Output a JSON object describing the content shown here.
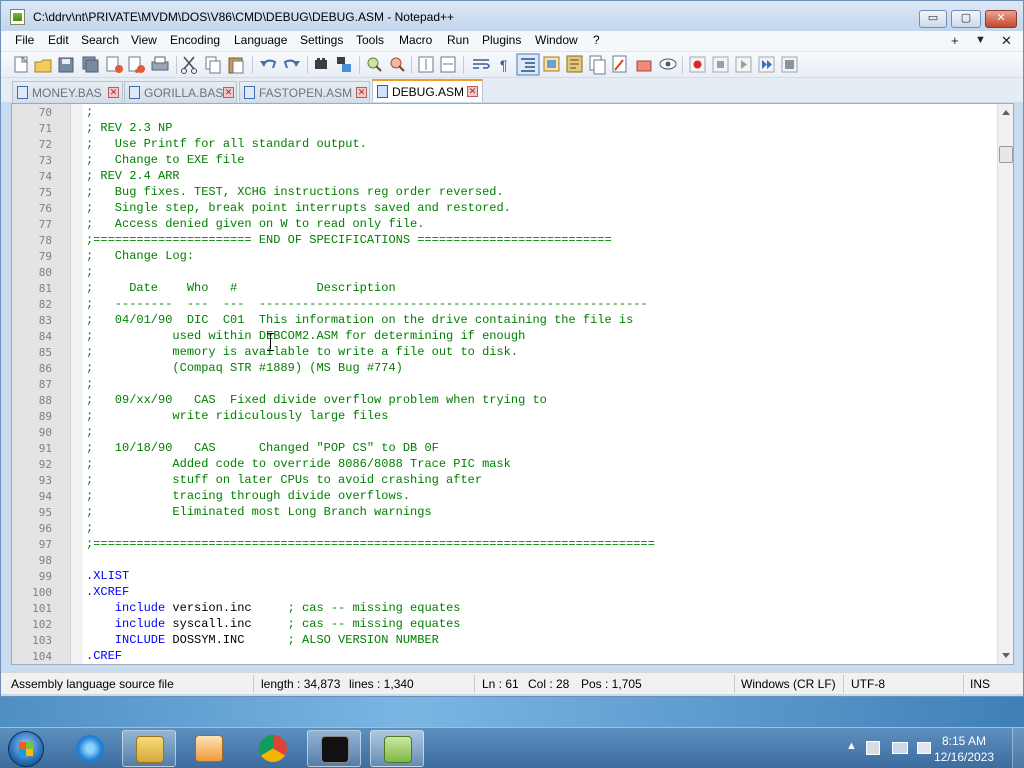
{
  "window": {
    "title": "C:\\ddrv\\nt\\PRIVATE\\MVDM\\DOS\\V86\\CMD\\DEBUG\\DEBUG.ASM - Notepad++",
    "min_glyph": "▭",
    "max_glyph": "▢",
    "close_glyph": "✕"
  },
  "menu": {
    "items": [
      "File",
      "Edit",
      "Search",
      "View",
      "Encoding",
      "Language",
      "Settings",
      "Tools",
      "Macro",
      "Run",
      "Plugins",
      "Window",
      "?"
    ],
    "right": [
      "+",
      "▼",
      "✕"
    ]
  },
  "toolbar": {
    "icons": [
      "new-file",
      "open-file",
      "save",
      "save-all",
      "close",
      "close-all",
      "print",
      "cut",
      "copy",
      "paste",
      "undo",
      "redo",
      "find",
      "replace",
      "zoom-in",
      "zoom-out",
      "sync-vertical",
      "word-wrap",
      "show-all-chars",
      "indent-guide",
      "user-defined-language",
      "document-map",
      "function-list",
      "folder-as-workspace",
      "monitoring",
      "macro-record",
      "macro-stop",
      "macro-play",
      "macro-run-multiple",
      "macro-save"
    ]
  },
  "tabs": [
    {
      "label": "MONEY.BAS",
      "active": false
    },
    {
      "label": "GORILLA.BAS",
      "active": false
    },
    {
      "label": "FASTOPEN.ASM",
      "active": false
    },
    {
      "label": "DEBUG.ASM",
      "active": true
    }
  ],
  "tab_close_glyph": "✕",
  "editor": {
    "lines": [
      {
        "n": "70",
        "parts": [
          {
            "t": ";",
            "c": "cmt"
          }
        ]
      },
      {
        "n": "71",
        "parts": [
          {
            "t": "; REV 2.3 NP",
            "c": "cmt"
          }
        ]
      },
      {
        "n": "72",
        "parts": [
          {
            "t": ";   Use Printf for all standard output.",
            "c": "cmt"
          }
        ]
      },
      {
        "n": "73",
        "parts": [
          {
            "t": ";   Change to EXE file",
            "c": "cmt"
          }
        ]
      },
      {
        "n": "74",
        "parts": [
          {
            "t": "; REV 2.4 ARR",
            "c": "cmt"
          }
        ]
      },
      {
        "n": "75",
        "parts": [
          {
            "t": ";   Bug fixes. TEST, XCHG instructions reg order reversed.",
            "c": "cmt"
          }
        ]
      },
      {
        "n": "76",
        "parts": [
          {
            "t": ";   Single step, break point interrupts saved and restored.",
            "c": "cmt"
          }
        ]
      },
      {
        "n": "77",
        "parts": [
          {
            "t": ";   Access denied given on W to read only file.",
            "c": "cmt"
          }
        ]
      },
      {
        "n": "78",
        "parts": [
          {
            "t": ";====================== END OF SPECIFICATIONS ===========================",
            "c": "cmt"
          }
        ]
      },
      {
        "n": "79",
        "parts": [
          {
            "t": ";   Change Log:",
            "c": "cmt"
          }
        ]
      },
      {
        "n": "80",
        "parts": [
          {
            "t": ";",
            "c": "cmt"
          }
        ]
      },
      {
        "n": "81",
        "parts": [
          {
            "t": ";     Date    Who   #           Description",
            "c": "cmt"
          }
        ]
      },
      {
        "n": "82",
        "parts": [
          {
            "t": ";   --------  ---  ---  ------------------------------------------------------",
            "c": "cmt"
          }
        ]
      },
      {
        "n": "83",
        "parts": [
          {
            "t": ";   04/01/90  DIC  C01  This information on the drive containing the file is",
            "c": "cmt"
          }
        ]
      },
      {
        "n": "84",
        "parts": [
          {
            "t": ";           used within DEBCOM2.ASM for determining if enough",
            "c": "cmt"
          }
        ]
      },
      {
        "n": "85",
        "parts": [
          {
            "t": ";           memory is available to write a file out to disk.",
            "c": "cmt"
          }
        ]
      },
      {
        "n": "86",
        "parts": [
          {
            "t": ";           (Compaq STR #1889) (MS Bug #774)",
            "c": "cmt"
          }
        ]
      },
      {
        "n": "87",
        "parts": [
          {
            "t": ";",
            "c": "cmt"
          }
        ]
      },
      {
        "n": "88",
        "parts": [
          {
            "t": ";   09/xx/90   CAS  Fixed divide overflow problem when trying to",
            "c": "cmt"
          }
        ]
      },
      {
        "n": "89",
        "parts": [
          {
            "t": ";           write ridiculously large files",
            "c": "cmt"
          }
        ]
      },
      {
        "n": "90",
        "parts": [
          {
            "t": ";",
            "c": "cmt"
          }
        ]
      },
      {
        "n": "91",
        "parts": [
          {
            "t": ";   10/18/90   CAS      Changed \"POP CS\" to DB 0F",
            "c": "cmt"
          }
        ]
      },
      {
        "n": "92",
        "parts": [
          {
            "t": ";           Added code to override 8086/8088 Trace PIC mask",
            "c": "cmt"
          }
        ]
      },
      {
        "n": "93",
        "parts": [
          {
            "t": ";           stuff on later CPUs to avoid crashing after",
            "c": "cmt"
          }
        ]
      },
      {
        "n": "94",
        "parts": [
          {
            "t": ";           tracing through divide overflows.",
            "c": "cmt"
          }
        ]
      },
      {
        "n": "95",
        "parts": [
          {
            "t": ";           Eliminated most Long Branch warnings",
            "c": "cmt"
          }
        ]
      },
      {
        "n": "96",
        "parts": [
          {
            "t": ";",
            "c": "cmt"
          }
        ]
      },
      {
        "n": "97",
        "parts": [
          {
            "t": ";==============================================================================",
            "c": "cmt"
          }
        ]
      },
      {
        "n": "98",
        "parts": []
      },
      {
        "n": "99",
        "parts": [
          {
            "t": ".XLIST",
            "c": "dir"
          }
        ]
      },
      {
        "n": "100",
        "parts": [
          {
            "t": ".XCREF",
            "c": "dir"
          }
        ]
      },
      {
        "n": "101",
        "parts": [
          {
            "t": "    include",
            "c": "dir"
          },
          {
            "t": " version.inc     ",
            "c": "plain"
          },
          {
            "t": "; cas -- missing equates",
            "c": "cmt"
          }
        ]
      },
      {
        "n": "102",
        "parts": [
          {
            "t": "    include",
            "c": "dir"
          },
          {
            "t": " syscall.inc     ",
            "c": "plain"
          },
          {
            "t": "; cas -- missing equates",
            "c": "cmt"
          }
        ]
      },
      {
        "n": "103",
        "parts": [
          {
            "t": "    INCLUDE",
            "c": "dir"
          },
          {
            "t": " DOSSYM.INC      ",
            "c": "plain"
          },
          {
            "t": "; ALSO VERSION NUMBER",
            "c": "cmt"
          }
        ]
      },
      {
        "n": "104",
        "parts": [
          {
            "t": ".CREF",
            "c": "dir"
          }
        ]
      }
    ]
  },
  "status": {
    "filetype": "Assembly language source file",
    "length": "length : 34,873",
    "lines": "lines : 1,340",
    "ln": "Ln : 61",
    "col": "Col : 28",
    "pos": "Pos : 1,705",
    "eol": "Windows (CR LF)",
    "encoding": "UTF-8",
    "mode": "INS"
  },
  "taskbar": {
    "apps": [
      "internet-explorer",
      "file-explorer",
      "media-player",
      "chrome",
      "command-prompt",
      "notepad-plus-plus"
    ],
    "tray_arrow": "▲",
    "time": "8:15 AM",
    "date": "12/16/2023"
  }
}
